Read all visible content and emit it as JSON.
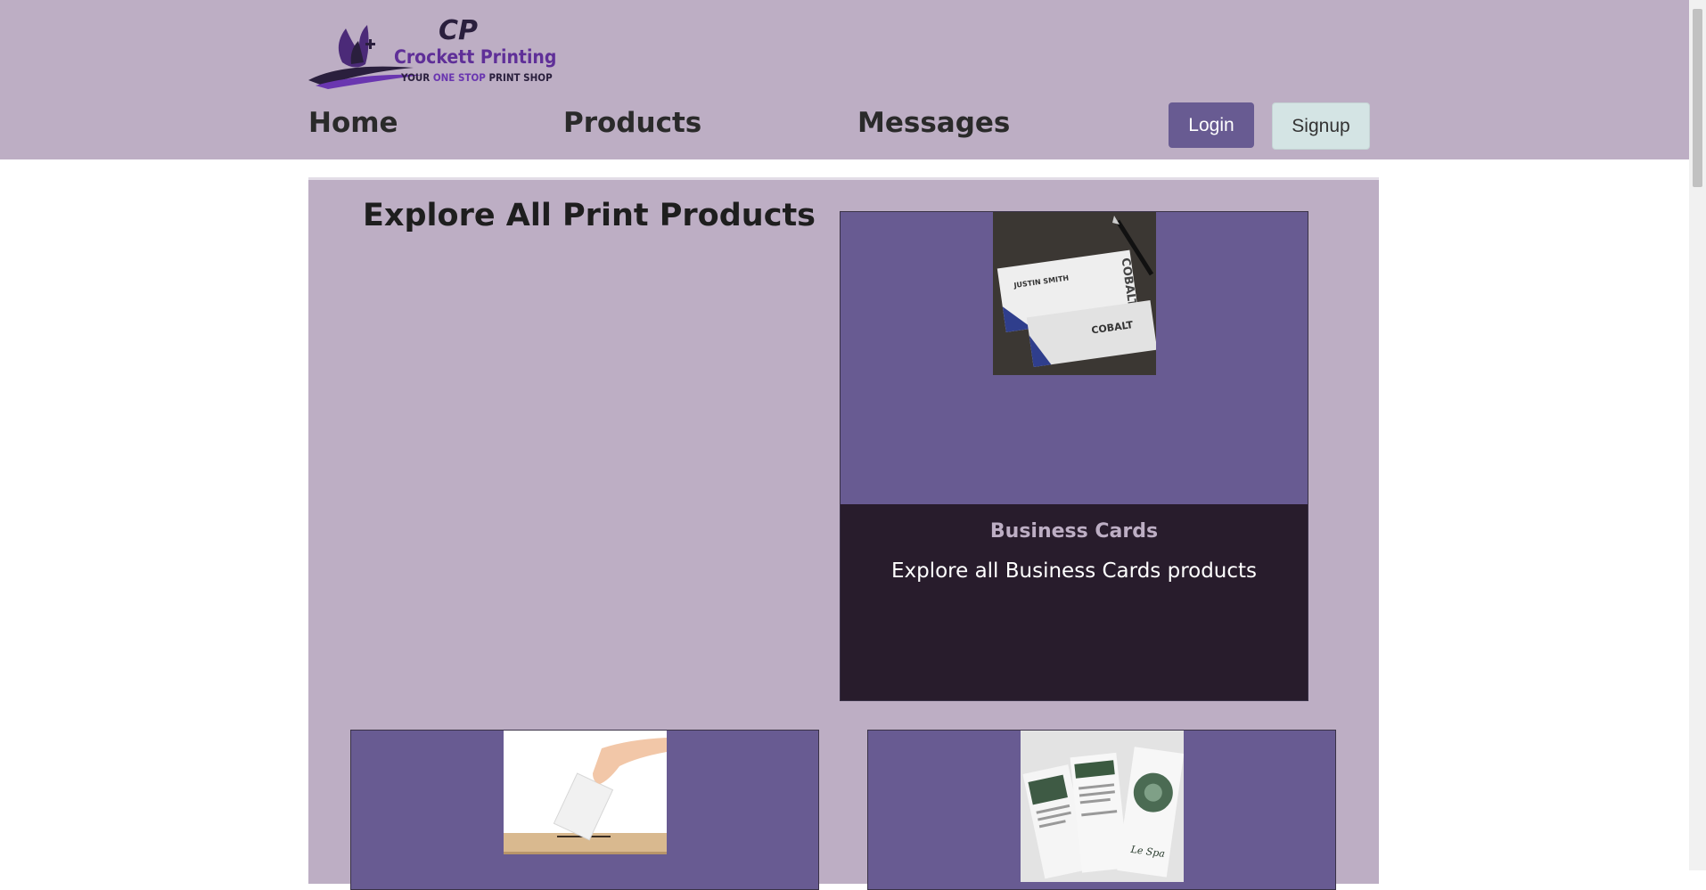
{
  "brand": {
    "name": "Crockett Printing",
    "tagline_pre": "YOUR ",
    "tagline_hl": "ONE STOP",
    "tagline_post": " PRINT SHOP",
    "monogram": "CP"
  },
  "nav": {
    "home": "Home",
    "products": "Products",
    "messages": "Messages"
  },
  "auth": {
    "login": "Login",
    "signup": "Signup"
  },
  "main": {
    "title": "Explore All Print Products",
    "cards": [
      {
        "title": "Business Cards",
        "description": "Explore all Business Cards products",
        "image": "business-cards-photo"
      },
      {
        "title": "",
        "description": "",
        "image": "ballot-box-photo"
      },
      {
        "title": "",
        "description": "",
        "image": "brochures-photo"
      }
    ]
  },
  "photo_text": {
    "name": "JUSTIN SMITH",
    "brand": "COBALT",
    "spa": "Le Spa"
  },
  "colors": {
    "header_bg": "#bdaec4",
    "card_bg": "#685b92",
    "card_body_bg": "#281c2c",
    "accent": "#5f2f98"
  }
}
